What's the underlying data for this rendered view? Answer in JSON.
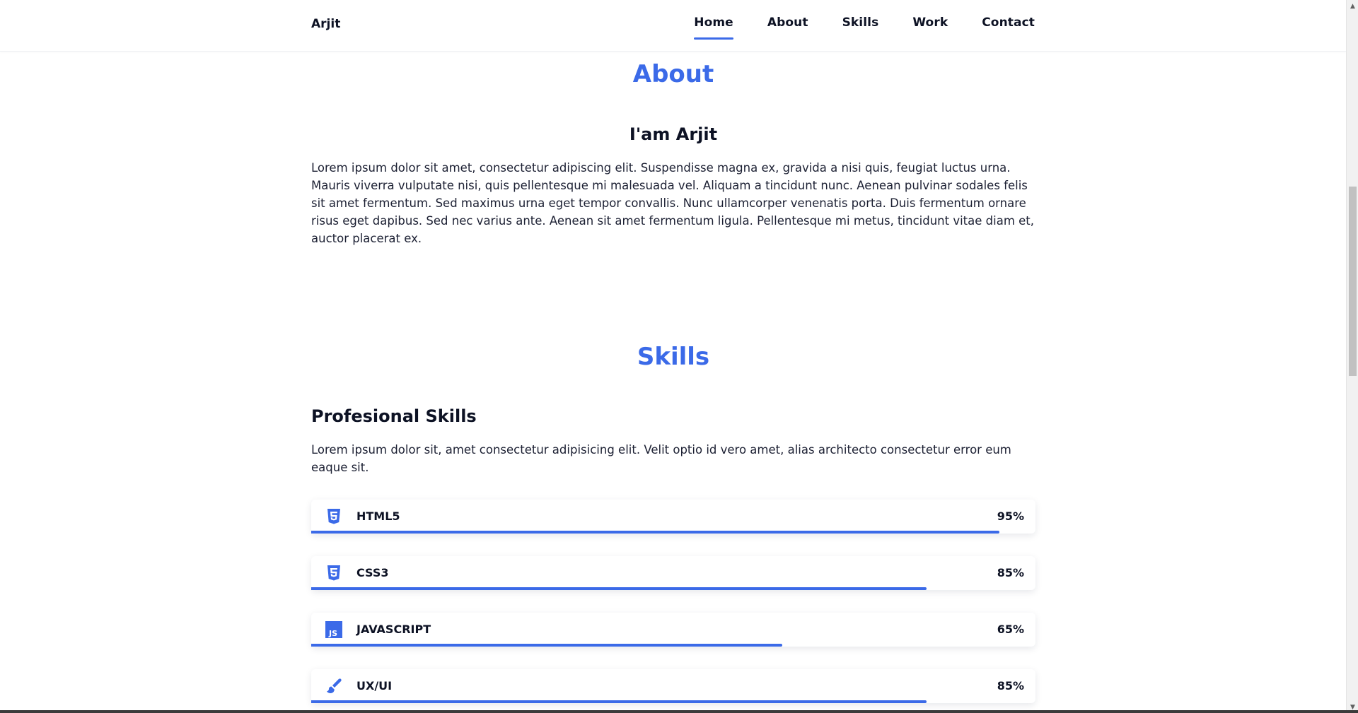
{
  "header": {
    "brand": "Arjit",
    "nav": [
      {
        "label": "Home",
        "active": true
      },
      {
        "label": "About",
        "active": false
      },
      {
        "label": "Skills",
        "active": false
      },
      {
        "label": "Work",
        "active": false
      },
      {
        "label": "Contact",
        "active": false
      }
    ]
  },
  "about": {
    "title": "About",
    "subtitle": "I'am Arjit",
    "text": "Lorem ipsum dolor sit amet, consectetur adipiscing elit. Suspendisse magna ex, gravida a nisi quis, feugiat luctus urna. Mauris viverra vulputate nisi, quis pellentesque mi malesuada vel. Aliquam a tincidunt nunc. Aenean pulvinar sodales felis sit amet fermentum. Sed maximus urna eget tempor convallis. Nunc ullamcorper venenatis porta. Duis fermentum ornare risus eget dapibus. Sed nec varius ante. Aenean sit amet fermentum ligula. Pellentesque mi metus, tincidunt vitae diam et, auctor placerat ex."
  },
  "skills": {
    "title": "Skills",
    "subtitle": "Profesional Skills",
    "text": "Lorem ipsum dolor sit, amet consectetur adipisicing elit. Velit optio id vero amet, alias architecto consectetur error eum eaque sit.",
    "items": [
      {
        "name": "HTML5",
        "percent_label": "95%",
        "level": 0.95,
        "icon": "html5-icon"
      },
      {
        "name": "CSS3",
        "percent_label": "85%",
        "level": 0.85,
        "icon": "css3-icon"
      },
      {
        "name": "JAVASCRIPT",
        "percent_label": "65%",
        "level": 0.65,
        "icon": "javascript-icon"
      },
      {
        "name": "UX/UI",
        "percent_label": "85%",
        "level": 0.85,
        "icon": "brush-icon"
      }
    ]
  },
  "colors": {
    "accent": "#3b6ae8",
    "text": "#0d1224"
  }
}
